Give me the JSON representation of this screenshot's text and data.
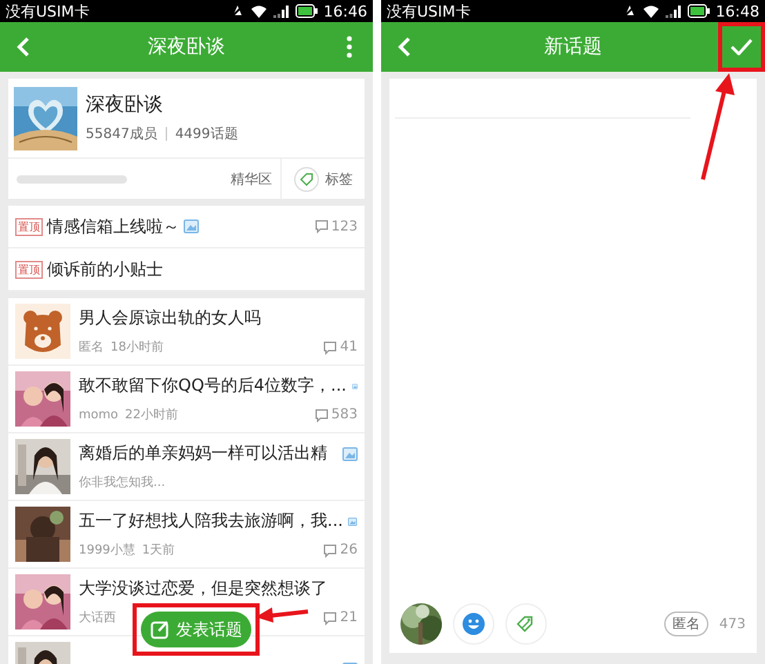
{
  "left": {
    "status_bar": {
      "carrier": "没有USIM卡",
      "time": "16:46"
    },
    "header": {
      "title": "深夜卧谈"
    },
    "group": {
      "name": "深夜卧谈",
      "members": "55847成员",
      "topics": "4499话题",
      "featured": "精华区",
      "tags": "标签"
    },
    "pinned": [
      {
        "badge": "置顶",
        "title": "情感信箱上线啦～",
        "has_image": true,
        "comments": "123"
      },
      {
        "badge": "置顶",
        "title": "倾诉前的小贴士",
        "has_image": false
      }
    ],
    "topics": [
      {
        "thumbnail": {
          "kind": "bear"
        },
        "title": "男人会原谅出轨的女人吗",
        "has_image": false,
        "author": "匿名",
        "time": "18小时前",
        "comments": "41"
      },
      {
        "title": "敢不敢留下你QQ号的后4位数字，...",
        "has_image": true,
        "author": "momo",
        "time": "22小时前",
        "comments": "583"
      },
      {
        "title": "离婚后的单亲妈妈一样可以活出精",
        "has_image": true,
        "author": "你非我怎知我..."
      },
      {
        "title": "五一了好想找人陪我去旅游啊，我...",
        "has_image": true,
        "author": "1999小慧",
        "time": "1天前",
        "comments": "26"
      },
      {
        "title": "大学没谈过恋爱，但是突然想谈了",
        "has_image": false,
        "author": "大话西",
        "comments": "21"
      },
      {
        "has_image": true
      }
    ],
    "post_button": {
      "label": "发表话题",
      "highlighted": true
    }
  },
  "right": {
    "status_bar": {
      "carrier": "没有USIM卡",
      "time": "16:48"
    },
    "header": {
      "title": "新话题",
      "confirm_highlighted": true
    },
    "composer": {
      "anonymous": "匿名",
      "remaining": "473"
    }
  }
}
